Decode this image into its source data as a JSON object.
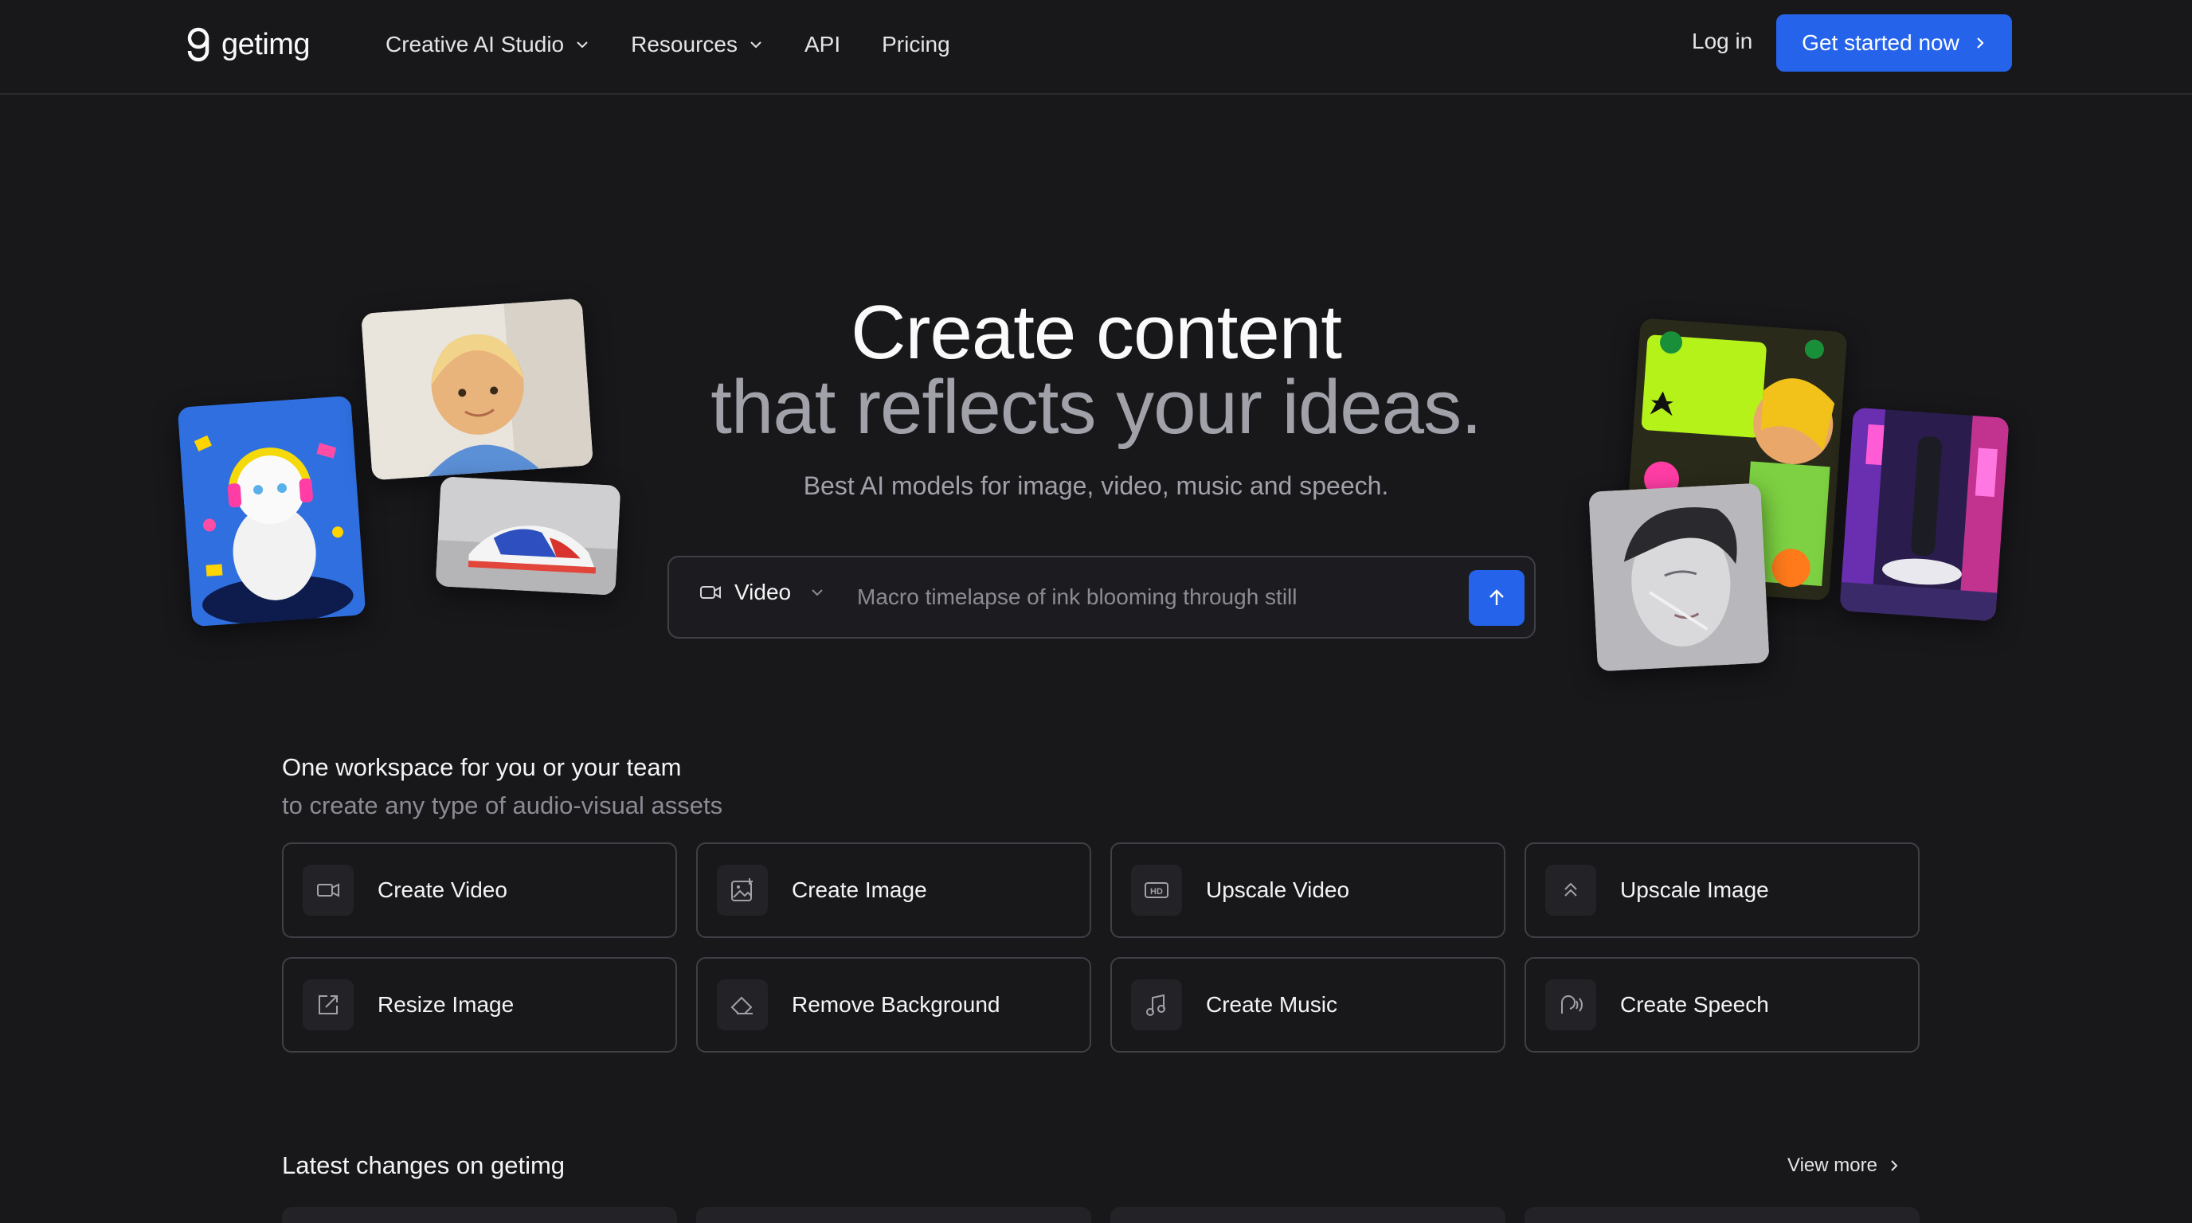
{
  "nav": {
    "logo_text": "getimg",
    "links": [
      {
        "label": "Creative AI Studio",
        "dropdown": true
      },
      {
        "label": "Resources",
        "dropdown": true
      },
      {
        "label": "API",
        "dropdown": false
      },
      {
        "label": "Pricing",
        "dropdown": false
      }
    ],
    "login_label": "Log in",
    "cta_label": "Get started now"
  },
  "hero": {
    "title_line1": "Create content",
    "title_line2": "that reflects your ideas.",
    "subtitle": "Best AI models for image, video, music and speech.",
    "prompt": {
      "mode": "Video",
      "placeholder": "Macro timelapse of ink blooming through still water",
      "value": ""
    }
  },
  "workspace": {
    "title": "One workspace for you or your team",
    "subtitle": "to create any type of audio-visual assets",
    "tools": [
      {
        "label": "Create Video",
        "icon": "video-camera-icon"
      },
      {
        "label": "Create Image",
        "icon": "image-sparkle-icon"
      },
      {
        "label": "Upscale Video",
        "icon": "hd-icon"
      },
      {
        "label": "Upscale Image",
        "icon": "double-chevron-up-icon"
      },
      {
        "label": "Resize Image",
        "icon": "resize-icon"
      },
      {
        "label": "Remove Background",
        "icon": "eraser-icon"
      },
      {
        "label": "Create Music",
        "icon": "music-note-icon"
      },
      {
        "label": "Create Speech",
        "icon": "speech-icon"
      }
    ]
  },
  "latest": {
    "title": "Latest changes on getimg",
    "view_more": "View more"
  },
  "colors": {
    "background": "#18181b",
    "accent": "#2563eb",
    "border": "#3f3f46",
    "muted_text": "#a1a1aa"
  }
}
